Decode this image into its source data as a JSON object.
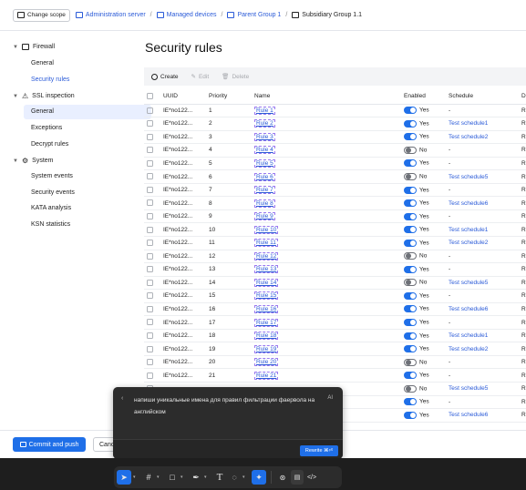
{
  "breadcrumb": {
    "change_scope": "Change scope",
    "items": [
      "Administration server",
      "Managed devices",
      "Parent Group 1",
      "Subsidiary Group 1.1"
    ]
  },
  "sidebar": {
    "sections": [
      {
        "label": "Firewall",
        "items": [
          "General",
          "Security rules"
        ]
      },
      {
        "label": "SSL inspection",
        "items": [
          "General",
          "Exceptions",
          "Decrypt rules"
        ]
      },
      {
        "label": "System",
        "items": [
          "System events",
          "Security events",
          "KATA analysis",
          "KSN statistics"
        ]
      }
    ],
    "active_item": "Security rules"
  },
  "page": {
    "title": "Security rules"
  },
  "toolbar": {
    "create": "Create",
    "edit": "Edit",
    "delete": "Delete"
  },
  "table": {
    "headers": [
      "UUID",
      "Priority",
      "Name",
      "Enabled",
      "Schedule",
      "D"
    ],
    "rows": [
      {
        "uuid": "IE*no122...",
        "priority": "1",
        "name": "Rule 1",
        "enabled": true,
        "enabled_label": "Yes",
        "schedule": "-",
        "d": "R"
      },
      {
        "uuid": "IE*no122...",
        "priority": "2",
        "name": "Rule 2",
        "enabled": true,
        "enabled_label": "Yes",
        "schedule": "Test schedule1",
        "d": "R"
      },
      {
        "uuid": "IE*no122...",
        "priority": "3",
        "name": "Rule 3",
        "enabled": true,
        "enabled_label": "Yes",
        "schedule": "Test schedule2",
        "d": "R"
      },
      {
        "uuid": "IE*no122...",
        "priority": "4",
        "name": "Rule 4",
        "enabled": false,
        "enabled_label": "No",
        "schedule": "-",
        "d": "R"
      },
      {
        "uuid": "IE*no122...",
        "priority": "5",
        "name": "Rule 5",
        "enabled": true,
        "enabled_label": "Yes",
        "schedule": "-",
        "d": "R"
      },
      {
        "uuid": "IE*no122...",
        "priority": "6",
        "name": "Rule 6",
        "enabled": false,
        "enabled_label": "No",
        "schedule": "Test schedule5",
        "d": "R"
      },
      {
        "uuid": "IE*no122...",
        "priority": "7",
        "name": "Rule 7",
        "enabled": true,
        "enabled_label": "Yes",
        "schedule": "-",
        "d": "R"
      },
      {
        "uuid": "IE*no122...",
        "priority": "8",
        "name": "Rule 8",
        "enabled": true,
        "enabled_label": "Yes",
        "schedule": "Test schedule6",
        "d": "R"
      },
      {
        "uuid": "IE*no122...",
        "priority": "9",
        "name": "Rule 9",
        "enabled": true,
        "enabled_label": "Yes",
        "schedule": "-",
        "d": "R"
      },
      {
        "uuid": "IE*no122...",
        "priority": "10",
        "name": "Rule 10",
        "enabled": true,
        "enabled_label": "Yes",
        "schedule": "Test schedule1",
        "d": "R"
      },
      {
        "uuid": "IE*no122...",
        "priority": "11",
        "name": "Rule 11",
        "enabled": true,
        "enabled_label": "Yes",
        "schedule": "Test schedule2",
        "d": "R"
      },
      {
        "uuid": "IE*no122...",
        "priority": "12",
        "name": "Rule 12",
        "enabled": false,
        "enabled_label": "No",
        "schedule": "-",
        "d": "R"
      },
      {
        "uuid": "IE*no122...",
        "priority": "13",
        "name": "Rule 13",
        "enabled": true,
        "enabled_label": "Yes",
        "schedule": "-",
        "d": "R"
      },
      {
        "uuid": "IE*no122...",
        "priority": "14",
        "name": "Rule 14",
        "enabled": false,
        "enabled_label": "No",
        "schedule": "Test schedule5",
        "d": "R"
      },
      {
        "uuid": "IE*no122...",
        "priority": "15",
        "name": "Rule 15",
        "enabled": true,
        "enabled_label": "Yes",
        "schedule": "-",
        "d": "R"
      },
      {
        "uuid": "IE*no122...",
        "priority": "16",
        "name": "Rule 16",
        "enabled": true,
        "enabled_label": "Yes",
        "schedule": "Test schedule6",
        "d": "R"
      },
      {
        "uuid": "IE*no122...",
        "priority": "17",
        "name": "Rule 17",
        "enabled": true,
        "enabled_label": "Yes",
        "schedule": "-",
        "d": "R"
      },
      {
        "uuid": "IE*no122...",
        "priority": "18",
        "name": "Rule 18",
        "enabled": true,
        "enabled_label": "Yes",
        "schedule": "Test schedule1",
        "d": "R"
      },
      {
        "uuid": "IE*no122...",
        "priority": "19",
        "name": "Rule 19",
        "enabled": true,
        "enabled_label": "Yes",
        "schedule": "Test schedule2",
        "d": "R"
      },
      {
        "uuid": "IE*no122...",
        "priority": "20",
        "name": "Rule 20",
        "enabled": false,
        "enabled_label": "No",
        "schedule": "-",
        "d": "R"
      },
      {
        "uuid": "IE*no122...",
        "priority": "21",
        "name": "Rule 21",
        "enabled": true,
        "enabled_label": "Yes",
        "schedule": "-",
        "d": "R"
      },
      {
        "uuid": "",
        "priority": "",
        "name": "",
        "enabled": false,
        "enabled_label": "No",
        "schedule": "Test schedule5",
        "d": "R"
      },
      {
        "uuid": "",
        "priority": "",
        "name": "",
        "enabled": true,
        "enabled_label": "Yes",
        "schedule": "-",
        "d": "R"
      },
      {
        "uuid": "",
        "priority": "",
        "name": "",
        "enabled": true,
        "enabled_label": "Yes",
        "schedule": "Test schedule6",
        "d": "R"
      }
    ]
  },
  "footer": {
    "commit": "Commit and push",
    "cancel": "Canc"
  },
  "ai_panel": {
    "prompt": "напиши уникальные имена для правил фильтрации фаервола на английском",
    "label": "AI",
    "rewrite": "Rewrite ⌘⏎"
  },
  "colors": {
    "accent": "#1f6fe8",
    "link": "#2b5bd8",
    "selection": "#9b7bf0"
  }
}
